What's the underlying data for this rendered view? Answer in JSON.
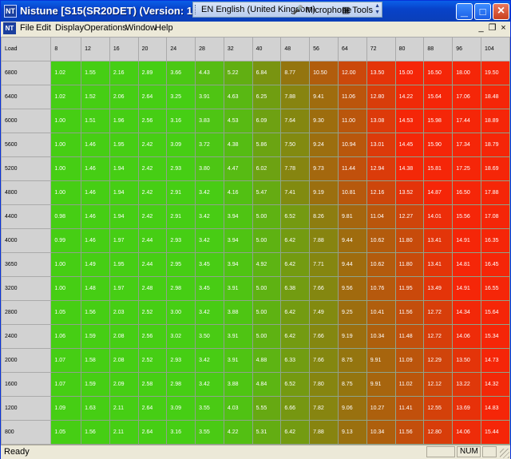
{
  "titlebar": {
    "title": "Nistune [S15(SR20DET) (Version: 1)] - [TKRM",
    "app_icon": "NT"
  },
  "language_bar": {
    "language": "EN English (United Kingdom)",
    "microphone": "Microphone",
    "tools": "Tools"
  },
  "window_controls": {
    "minimize": "_",
    "maximize": "□",
    "close": "×"
  },
  "menubar": {
    "items": [
      {
        "label": "File",
        "key": "F"
      },
      {
        "label": "Edit",
        "key": "E"
      },
      {
        "label": "Display",
        "key": "D"
      },
      {
        "label": "Operations",
        "key": "O"
      },
      {
        "label": "Window",
        "key": "W"
      },
      {
        "label": "Help",
        "key": "H"
      }
    ],
    "doc_controls": [
      "_",
      "❐",
      "×"
    ]
  },
  "table": {
    "corner_label": "Load",
    "columns": [
      "8",
      "12",
      "16",
      "20",
      "24",
      "28",
      "32",
      "40",
      "48",
      "56",
      "64",
      "72",
      "80",
      "88",
      "96",
      "104"
    ],
    "rows": [
      {
        "rpm": "6800",
        "values": [
          "1.02",
          "1.55",
          "2.16",
          "2.89",
          "3.66",
          "4.43",
          "5.22",
          "6.84",
          "8.77",
          "10.50",
          "12.00",
          "13.50",
          "15.00",
          "16.50",
          "18.00",
          "19.50"
        ]
      },
      {
        "rpm": "6400",
        "values": [
          "1.02",
          "1.52",
          "2.06",
          "2.64",
          "3.25",
          "3.91",
          "4.63",
          "6.25",
          "7.88",
          "9.41",
          "11.06",
          "12.80",
          "14.22",
          "15.64",
          "17.06",
          "18.48"
        ]
      },
      {
        "rpm": "6000",
        "values": [
          "1.00",
          "1.51",
          "1.96",
          "2.56",
          "3.16",
          "3.83",
          "4.53",
          "6.09",
          "7.64",
          "9.30",
          "11.00",
          "13.08",
          "14.53",
          "15.98",
          "17.44",
          "18.89"
        ]
      },
      {
        "rpm": "5600",
        "values": [
          "1.00",
          "1.46",
          "1.95",
          "2.42",
          "3.09",
          "3.72",
          "4.38",
          "5.86",
          "7.50",
          "9.24",
          "10.94",
          "13.01",
          "14.45",
          "15.90",
          "17.34",
          "18.79"
        ]
      },
      {
        "rpm": "5200",
        "values": [
          "1.00",
          "1.46",
          "1.94",
          "2.42",
          "2.93",
          "3.80",
          "4.47",
          "6.02",
          "7.78",
          "9.73",
          "11.44",
          "12.94",
          "14.38",
          "15.81",
          "17.25",
          "18.69"
        ]
      },
      {
        "rpm": "4800",
        "values": [
          "1.00",
          "1.46",
          "1.94",
          "2.42",
          "2.91",
          "3.42",
          "4.16",
          "5.47",
          "7.41",
          "9.19",
          "10.81",
          "12.16",
          "13.52",
          "14.87",
          "16.50",
          "17.88"
        ]
      },
      {
        "rpm": "4400",
        "values": [
          "0.98",
          "1.46",
          "1.94",
          "2.42",
          "2.91",
          "3.42",
          "3.94",
          "5.00",
          "6.52",
          "8.26",
          "9.81",
          "11.04",
          "12.27",
          "14.01",
          "15.56",
          "17.08"
        ]
      },
      {
        "rpm": "4000",
        "values": [
          "0.99",
          "1.46",
          "1.97",
          "2.44",
          "2.93",
          "3.42",
          "3.94",
          "5.00",
          "6.42",
          "7.88",
          "9.44",
          "10.62",
          "11.80",
          "13.41",
          "14.91",
          "16.35"
        ]
      },
      {
        "rpm": "3650",
        "values": [
          "1.00",
          "1.49",
          "1.95",
          "2.44",
          "2.95",
          "3.45",
          "3.94",
          "4.92",
          "6.42",
          "7.71",
          "9.44",
          "10.62",
          "11.80",
          "13.41",
          "14.81",
          "16.45"
        ]
      },
      {
        "rpm": "3200",
        "values": [
          "1.00",
          "1.48",
          "1.97",
          "2.48",
          "2.98",
          "3.45",
          "3.91",
          "5.00",
          "6.38",
          "7.66",
          "9.56",
          "10.76",
          "11.95",
          "13.49",
          "14.91",
          "16.55"
        ]
      },
      {
        "rpm": "2800",
        "values": [
          "1.05",
          "1.56",
          "2.03",
          "2.52",
          "3.00",
          "3.42",
          "3.88",
          "5.00",
          "6.42",
          "7.49",
          "9.25",
          "10.41",
          "11.56",
          "12.72",
          "14.34",
          "15.64"
        ]
      },
      {
        "rpm": "2400",
        "values": [
          "1.06",
          "1.59",
          "2.08",
          "2.56",
          "3.02",
          "3.50",
          "3.91",
          "5.00",
          "6.42",
          "7.66",
          "9.19",
          "10.34",
          "11.48",
          "12.72",
          "14.06",
          "15.34"
        ]
      },
      {
        "rpm": "2000",
        "values": [
          "1.07",
          "1.58",
          "2.08",
          "2.52",
          "2.93",
          "3.42",
          "3.91",
          "4.88",
          "6.33",
          "7.66",
          "8.75",
          "9.91",
          "11.09",
          "12.29",
          "13.50",
          "14.73"
        ]
      },
      {
        "rpm": "1600",
        "values": [
          "1.07",
          "1.59",
          "2.09",
          "2.58",
          "2.98",
          "3.42",
          "3.88",
          "4.84",
          "6.52",
          "7.80",
          "8.75",
          "9.91",
          "11.02",
          "12.12",
          "13.22",
          "14.32"
        ]
      },
      {
        "rpm": "1200",
        "values": [
          "1.09",
          "1.63",
          "2.11",
          "2.64",
          "3.09",
          "3.55",
          "4.03",
          "5.55",
          "6.66",
          "7.82",
          "9.06",
          "10.27",
          "11.41",
          "12.55",
          "13.69",
          "14.83"
        ]
      },
      {
        "rpm": "800",
        "values": [
          "1.05",
          "1.56",
          "2.11",
          "2.64",
          "3.16",
          "3.55",
          "4.22",
          "5.31",
          "6.42",
          "7.88",
          "9.13",
          "10.34",
          "11.56",
          "12.80",
          "14.06",
          "15.44"
        ]
      }
    ]
  },
  "statusbar": {
    "text": "Ready",
    "num_indicator": "NUM"
  }
}
